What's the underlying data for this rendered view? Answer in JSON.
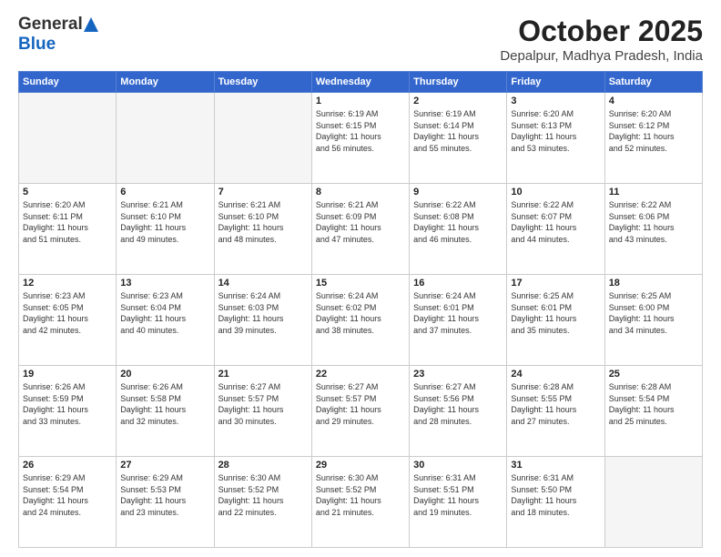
{
  "header": {
    "logo_general": "General",
    "logo_blue": "Blue",
    "title": "October 2025",
    "subtitle": "Depalpur, Madhya Pradesh, India"
  },
  "days_of_week": [
    "Sunday",
    "Monday",
    "Tuesday",
    "Wednesday",
    "Thursday",
    "Friday",
    "Saturday"
  ],
  "weeks": [
    [
      {
        "day": "",
        "info": ""
      },
      {
        "day": "",
        "info": ""
      },
      {
        "day": "",
        "info": ""
      },
      {
        "day": "1",
        "info": "Sunrise: 6:19 AM\nSunset: 6:15 PM\nDaylight: 11 hours\nand 56 minutes."
      },
      {
        "day": "2",
        "info": "Sunrise: 6:19 AM\nSunset: 6:14 PM\nDaylight: 11 hours\nand 55 minutes."
      },
      {
        "day": "3",
        "info": "Sunrise: 6:20 AM\nSunset: 6:13 PM\nDaylight: 11 hours\nand 53 minutes."
      },
      {
        "day": "4",
        "info": "Sunrise: 6:20 AM\nSunset: 6:12 PM\nDaylight: 11 hours\nand 52 minutes."
      }
    ],
    [
      {
        "day": "5",
        "info": "Sunrise: 6:20 AM\nSunset: 6:11 PM\nDaylight: 11 hours\nand 51 minutes."
      },
      {
        "day": "6",
        "info": "Sunrise: 6:21 AM\nSunset: 6:10 PM\nDaylight: 11 hours\nand 49 minutes."
      },
      {
        "day": "7",
        "info": "Sunrise: 6:21 AM\nSunset: 6:10 PM\nDaylight: 11 hours\nand 48 minutes."
      },
      {
        "day": "8",
        "info": "Sunrise: 6:21 AM\nSunset: 6:09 PM\nDaylight: 11 hours\nand 47 minutes."
      },
      {
        "day": "9",
        "info": "Sunrise: 6:22 AM\nSunset: 6:08 PM\nDaylight: 11 hours\nand 46 minutes."
      },
      {
        "day": "10",
        "info": "Sunrise: 6:22 AM\nSunset: 6:07 PM\nDaylight: 11 hours\nand 44 minutes."
      },
      {
        "day": "11",
        "info": "Sunrise: 6:22 AM\nSunset: 6:06 PM\nDaylight: 11 hours\nand 43 minutes."
      }
    ],
    [
      {
        "day": "12",
        "info": "Sunrise: 6:23 AM\nSunset: 6:05 PM\nDaylight: 11 hours\nand 42 minutes."
      },
      {
        "day": "13",
        "info": "Sunrise: 6:23 AM\nSunset: 6:04 PM\nDaylight: 11 hours\nand 40 minutes."
      },
      {
        "day": "14",
        "info": "Sunrise: 6:24 AM\nSunset: 6:03 PM\nDaylight: 11 hours\nand 39 minutes."
      },
      {
        "day": "15",
        "info": "Sunrise: 6:24 AM\nSunset: 6:02 PM\nDaylight: 11 hours\nand 38 minutes."
      },
      {
        "day": "16",
        "info": "Sunrise: 6:24 AM\nSunset: 6:01 PM\nDaylight: 11 hours\nand 37 minutes."
      },
      {
        "day": "17",
        "info": "Sunrise: 6:25 AM\nSunset: 6:01 PM\nDaylight: 11 hours\nand 35 minutes."
      },
      {
        "day": "18",
        "info": "Sunrise: 6:25 AM\nSunset: 6:00 PM\nDaylight: 11 hours\nand 34 minutes."
      }
    ],
    [
      {
        "day": "19",
        "info": "Sunrise: 6:26 AM\nSunset: 5:59 PM\nDaylight: 11 hours\nand 33 minutes."
      },
      {
        "day": "20",
        "info": "Sunrise: 6:26 AM\nSunset: 5:58 PM\nDaylight: 11 hours\nand 32 minutes."
      },
      {
        "day": "21",
        "info": "Sunrise: 6:27 AM\nSunset: 5:57 PM\nDaylight: 11 hours\nand 30 minutes."
      },
      {
        "day": "22",
        "info": "Sunrise: 6:27 AM\nSunset: 5:57 PM\nDaylight: 11 hours\nand 29 minutes."
      },
      {
        "day": "23",
        "info": "Sunrise: 6:27 AM\nSunset: 5:56 PM\nDaylight: 11 hours\nand 28 minutes."
      },
      {
        "day": "24",
        "info": "Sunrise: 6:28 AM\nSunset: 5:55 PM\nDaylight: 11 hours\nand 27 minutes."
      },
      {
        "day": "25",
        "info": "Sunrise: 6:28 AM\nSunset: 5:54 PM\nDaylight: 11 hours\nand 25 minutes."
      }
    ],
    [
      {
        "day": "26",
        "info": "Sunrise: 6:29 AM\nSunset: 5:54 PM\nDaylight: 11 hours\nand 24 minutes."
      },
      {
        "day": "27",
        "info": "Sunrise: 6:29 AM\nSunset: 5:53 PM\nDaylight: 11 hours\nand 23 minutes."
      },
      {
        "day": "28",
        "info": "Sunrise: 6:30 AM\nSunset: 5:52 PM\nDaylight: 11 hours\nand 22 minutes."
      },
      {
        "day": "29",
        "info": "Sunrise: 6:30 AM\nSunset: 5:52 PM\nDaylight: 11 hours\nand 21 minutes."
      },
      {
        "day": "30",
        "info": "Sunrise: 6:31 AM\nSunset: 5:51 PM\nDaylight: 11 hours\nand 19 minutes."
      },
      {
        "day": "31",
        "info": "Sunrise: 6:31 AM\nSunset: 5:50 PM\nDaylight: 11 hours\nand 18 minutes."
      },
      {
        "day": "",
        "info": ""
      }
    ]
  ]
}
